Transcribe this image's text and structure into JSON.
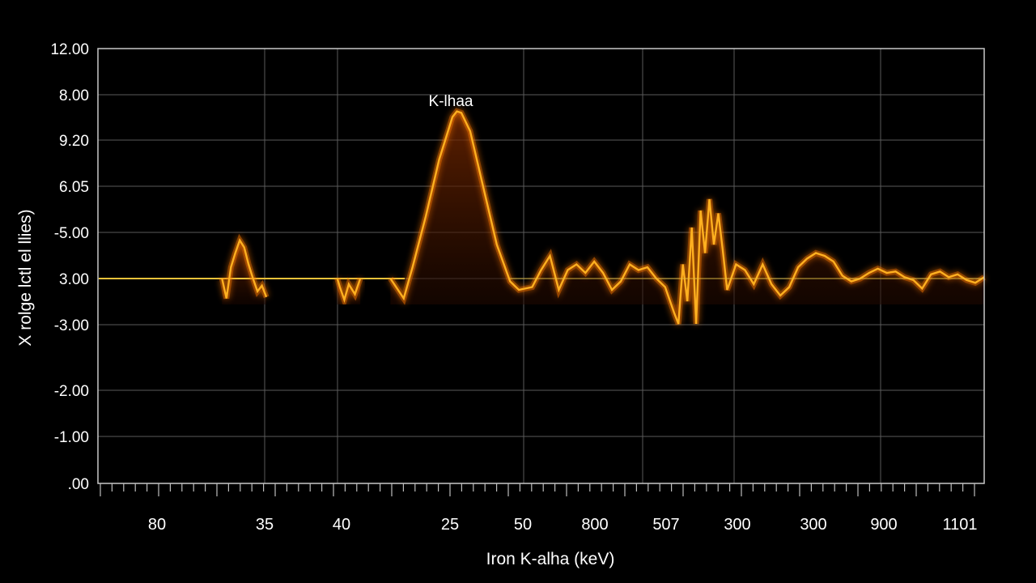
{
  "chart_data": {
    "type": "line",
    "title": "",
    "xlabel": "Iron K-alha (keV)",
    "ylabel": "X rolge lctl el llies)",
    "y_tick_labels": [
      "12.00",
      "8.00",
      "9.20",
      "6.05",
      "-5.00",
      "3.00",
      "-3.00",
      "-2.00",
      "-1.00",
      ".00"
    ],
    "x_tick_labels": [
      "80",
      "35",
      "40",
      "25",
      "50",
      "800",
      "507",
      "300",
      "300",
      "900",
      "1101"
    ],
    "annotation": "K-lhaa",
    "baseline_y_label": "3.00",
    "grid": true,
    "colors": {
      "background": "#000000",
      "grid": "#5a5a5a",
      "axis": "#c8c8c8",
      "line": "#ffb020",
      "glow": "#ff7a00",
      "baseline": "#e8c23a",
      "fill": "#5a1800"
    },
    "series": [
      {
        "values": [
          [
            0.0,
            0.0
          ],
          [
            0.14,
            0.0
          ],
          [
            0.145,
            -0.7
          ],
          [
            0.15,
            0.4
          ],
          [
            0.155,
            0.9
          ],
          [
            0.16,
            1.35
          ],
          [
            0.165,
            1.1
          ],
          [
            0.17,
            0.5
          ],
          [
            0.175,
            0.0
          ],
          [
            0.18,
            -0.45
          ],
          [
            0.185,
            -0.25
          ],
          [
            0.19,
            -0.65
          ],
          [
            0.27,
            0.0
          ],
          [
            0.273,
            -0.3
          ],
          [
            0.278,
            -0.75
          ],
          [
            0.283,
            -0.2
          ],
          [
            0.29,
            -0.55
          ],
          [
            0.296,
            0.0
          ],
          [
            0.33,
            0.0
          ],
          [
            0.345,
            -0.7
          ],
          [
            0.355,
            0.4
          ],
          [
            0.37,
            2.2
          ],
          [
            0.385,
            4.2
          ],
          [
            0.4,
            5.7
          ],
          [
            0.405,
            5.9
          ],
          [
            0.41,
            5.85
          ],
          [
            0.42,
            5.2
          ],
          [
            0.435,
            3.2
          ],
          [
            0.45,
            1.2
          ],
          [
            0.465,
            -0.1
          ],
          [
            0.475,
            -0.4
          ],
          [
            0.49,
            -0.3
          ],
          [
            0.5,
            0.3
          ],
          [
            0.51,
            0.8
          ],
          [
            0.52,
            -0.4
          ],
          [
            0.53,
            0.3
          ],
          [
            0.54,
            0.5
          ],
          [
            0.55,
            0.2
          ],
          [
            0.56,
            0.6
          ],
          [
            0.57,
            0.2
          ],
          [
            0.58,
            -0.4
          ],
          [
            0.59,
            -0.1
          ],
          [
            0.6,
            0.5
          ],
          [
            0.61,
            0.3
          ],
          [
            0.62,
            0.4
          ],
          [
            0.63,
            0.0
          ],
          [
            0.64,
            -0.3
          ],
          [
            0.65,
            -1.2
          ],
          [
            0.655,
            -1.6
          ],
          [
            0.66,
            0.5
          ],
          [
            0.665,
            -0.8
          ],
          [
            0.67,
            1.8
          ],
          [
            0.675,
            -1.6
          ],
          [
            0.68,
            2.4
          ],
          [
            0.685,
            0.9
          ],
          [
            0.69,
            2.8
          ],
          [
            0.695,
            1.2
          ],
          [
            0.7,
            2.3
          ],
          [
            0.705,
            1.0
          ],
          [
            0.71,
            -0.4
          ],
          [
            0.72,
            0.5
          ],
          [
            0.73,
            0.3
          ],
          [
            0.74,
            -0.2
          ],
          [
            0.75,
            0.5
          ],
          [
            0.76,
            -0.2
          ],
          [
            0.77,
            -0.6
          ],
          [
            0.78,
            -0.3
          ],
          [
            0.79,
            0.4
          ],
          [
            0.8,
            0.7
          ],
          [
            0.81,
            0.9
          ],
          [
            0.82,
            0.8
          ],
          [
            0.83,
            0.6
          ],
          [
            0.84,
            0.1
          ],
          [
            0.85,
            -0.1
          ],
          [
            0.86,
            0.0
          ],
          [
            0.87,
            0.2
          ],
          [
            0.88,
            0.35
          ],
          [
            0.89,
            0.2
          ],
          [
            0.9,
            0.25
          ],
          [
            0.91,
            0.05
          ],
          [
            0.92,
            -0.05
          ],
          [
            0.93,
            -0.35
          ],
          [
            0.94,
            0.15
          ],
          [
            0.95,
            0.25
          ],
          [
            0.96,
            0.05
          ],
          [
            0.97,
            0.15
          ],
          [
            0.98,
            -0.05
          ],
          [
            0.99,
            -0.15
          ],
          [
            1.0,
            0.05
          ]
        ]
      }
    ],
    "notes_axis": "x positions are normalized 0-1 along the horizontal axis; y values in units of baseline offset (baseline = 3.00 label)"
  }
}
